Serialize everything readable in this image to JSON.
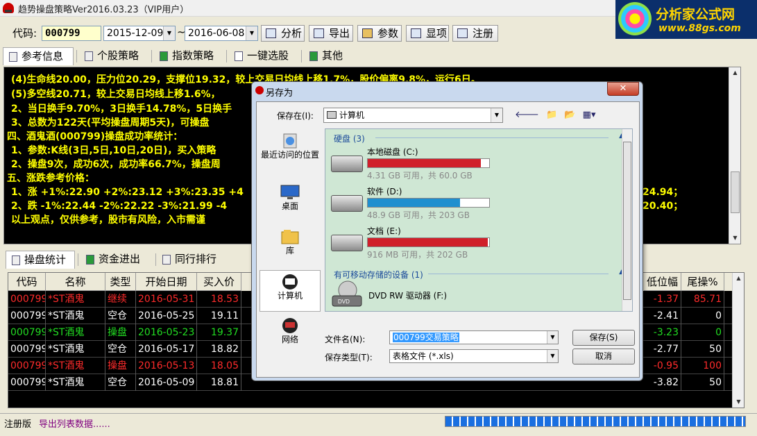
{
  "window": {
    "title": "趋势操盘策略Ver2016.03.23（VIP用户）"
  },
  "logo": {
    "name": "分析家公式网",
    "url": "www.88gs.com"
  },
  "toolbar": {
    "code_label": "代码:",
    "code_value": "000799",
    "date_from": "2015-12-09",
    "date_sep": "~",
    "date_to": "2016-06-08",
    "buttons": [
      "分析",
      "导出",
      "参数",
      "显项",
      "注册"
    ]
  },
  "tabs": [
    "参考信息",
    "个股策略",
    "指数策略",
    "一键选股",
    "其他"
  ],
  "console_lines": [
    "(4)生命线20.00，压力位20.29，支撑位19.32，较上交易日均线上移1.7%，股价偏离9.8%，运行6日。",
    "(5)多空线20.71，较上交易日均线上移1.6%，",
    "2、当日换手9.70%，3日换手14.78%，5日换手",
    "3、总数为122天(平均操盘周期5天)，可操盘",
    "四、酒鬼酒(000799)操盘成功率统计：",
    "1、参数:K线(3日,5日,10日,20日)，买入策略",
    "2、操盘9次，成功6次，成功率66.7%，操盘周",
    "五、涨跌参考价格：",
    "1、涨 +1%:22.90 +2%:23.12 +3%:23.35 +4",
    "2、跌 -1%:22.44 -2%:22.22 -3%:21.99 -4",
    "以上观点，仅供参考，股市有风险，入市需谨"
  ],
  "console_right": [
    "24.94；",
    "20.40；"
  ],
  "bottom_tabs": [
    "操盘统计",
    "资金进出",
    "同行排行"
  ],
  "table": {
    "headers": [
      "代码",
      "名称",
      "类型",
      "开始日期",
      "买入价",
      "低位幅",
      "尾操%"
    ],
    "rows": [
      {
        "code": "000799",
        "name": "*ST酒鬼",
        "type": "继续",
        "date": "2016-05-31",
        "price": "18.53",
        "low": "-1.37",
        "tail": "85.71",
        "color": "red"
      },
      {
        "code": "000799",
        "name": "*ST酒鬼",
        "type": "空仓",
        "date": "2016-05-25",
        "price": "19.11",
        "low": "-2.41",
        "tail": "0",
        "color": "white"
      },
      {
        "code": "000799",
        "name": "*ST酒鬼",
        "type": "操盘",
        "date": "2016-05-23",
        "price": "19.37",
        "low": "-3.23",
        "tail": "0",
        "color": "green"
      },
      {
        "code": "000799",
        "name": "*ST酒鬼",
        "type": "空仓",
        "date": "2016-05-17",
        "price": "18.82",
        "low": "-2.77",
        "tail": "50",
        "color": "white"
      },
      {
        "code": "000799",
        "name": "*ST酒鬼",
        "type": "操盘",
        "date": "2016-05-13",
        "price": "18.05",
        "low": "-0.95",
        "tail": "100",
        "color": "red"
      },
      {
        "code": "000799",
        "name": "*ST酒鬼",
        "type": "空仓",
        "date": "2016-05-09",
        "price": "18.81",
        "low": "-3.82",
        "tail": "50",
        "color": "white"
      }
    ]
  },
  "status": {
    "edition": "注册版",
    "message": "导出列表数据......"
  },
  "dialog": {
    "title": "另存为",
    "close": "✕",
    "save_in_label": "保存在(I):",
    "save_in_value": "计算机",
    "places": [
      "最近访问的位置",
      "桌面",
      "库",
      "计算机",
      "网络"
    ],
    "group_hdd": "硬盘 (3)",
    "group_removable": "有可移动存储的设备 (1)",
    "drives": [
      {
        "name": "本地磁盘 (C:)",
        "info": "4.31 GB 可用，共 60.0 GB",
        "used": 0.93,
        "color": "#d0202a"
      },
      {
        "name": "软件 (D:)",
        "info": "48.9 GB 可用，共 203 GB",
        "used": 0.76,
        "color": "#1f8fcf"
      },
      {
        "name": "文档 (E:)",
        "info": "916 MB 可用，共 202 GB",
        "used": 0.99,
        "color": "#d0202a"
      }
    ],
    "dvd": {
      "name": "DVD RW 驱动器 (F:)",
      "badge": "DVD"
    },
    "filename_label": "文件名(N):",
    "filename_value": "000799交易策略",
    "filetype_label": "保存类型(T):",
    "filetype_value": "表格文件 (*.xls)",
    "save_button": "保存(S)",
    "cancel_button": "取消"
  }
}
